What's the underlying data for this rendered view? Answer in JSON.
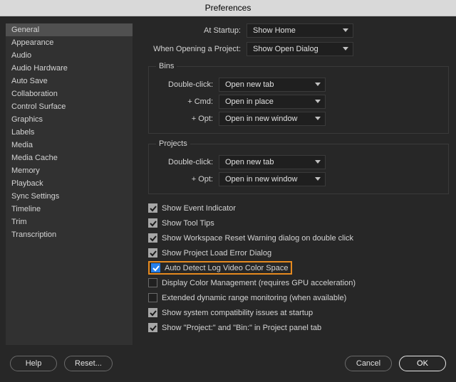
{
  "title": "Preferences",
  "sidebar": {
    "items": [
      {
        "label": "General",
        "selected": true
      },
      {
        "label": "Appearance"
      },
      {
        "label": "Audio"
      },
      {
        "label": "Audio Hardware"
      },
      {
        "label": "Auto Save"
      },
      {
        "label": "Collaboration"
      },
      {
        "label": "Control Surface"
      },
      {
        "label": "Graphics"
      },
      {
        "label": "Labels"
      },
      {
        "label": "Media"
      },
      {
        "label": "Media Cache"
      },
      {
        "label": "Memory"
      },
      {
        "label": "Playback"
      },
      {
        "label": "Sync Settings"
      },
      {
        "label": "Timeline"
      },
      {
        "label": "Trim"
      },
      {
        "label": "Transcription"
      }
    ]
  },
  "general": {
    "startup_label": "At Startup:",
    "startup_value": "Show Home",
    "open_project_label": "When Opening a Project:",
    "open_project_value": "Show Open Dialog",
    "bins": {
      "legend": "Bins",
      "double_click_label": "Double-click:",
      "double_click_value": "Open new tab",
      "cmd_label": "+ Cmd:",
      "cmd_value": "Open in place",
      "opt_label": "+ Opt:",
      "opt_value": "Open in new window"
    },
    "projects": {
      "legend": "Projects",
      "double_click_label": "Double-click:",
      "double_click_value": "Open new tab",
      "opt_label": "+ Opt:",
      "opt_value": "Open in new window"
    },
    "checks": [
      {
        "label": "Show Event Indicator",
        "checked": true
      },
      {
        "label": "Show Tool Tips",
        "checked": true
      },
      {
        "label": "Show Workspace Reset Warning dialog on double click",
        "checked": true
      },
      {
        "label": "Show Project Load Error Dialog",
        "checked": true
      },
      {
        "label": "Auto Detect Log Video Color Space",
        "checked": true,
        "highlighted": true
      },
      {
        "label": "Display Color Management (requires GPU acceleration)",
        "checked": false
      },
      {
        "label": "Extended dynamic range monitoring (when available)",
        "checked": false
      },
      {
        "label": "Show system compatibility issues at startup",
        "checked": true
      },
      {
        "label": "Show \"Project:\" and \"Bin:\" in Project panel tab",
        "checked": true
      }
    ]
  },
  "footer": {
    "help": "Help",
    "reset": "Reset...",
    "cancel": "Cancel",
    "ok": "OK"
  }
}
